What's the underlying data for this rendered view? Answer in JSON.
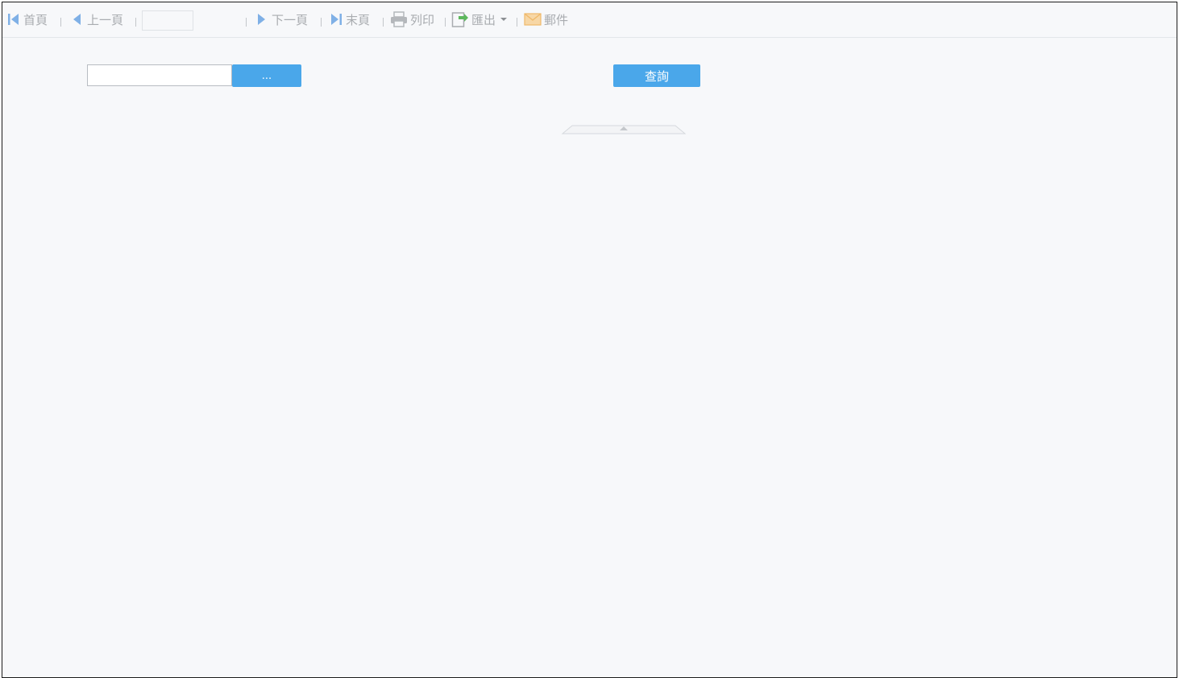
{
  "toolbar": {
    "first_page": "首頁",
    "prev_page": "上一頁",
    "page_input_value": "",
    "next_page": "下一頁",
    "last_page": "末頁",
    "print": "列印",
    "export": "匯出",
    "email": "郵件"
  },
  "params": {
    "text_value": "",
    "browse_button": "...",
    "query_button": "查詢"
  },
  "icons": {
    "first_page": "first-page-icon",
    "prev_page": "prev-page-icon",
    "next_page": "next-page-icon",
    "last_page": "last-page-icon",
    "print": "printer-icon",
    "export": "export-icon",
    "email": "mail-icon",
    "collapse": "collapse-up-icon"
  },
  "colors": {
    "accent": "#4aa7ea",
    "nav_icon": "#7fb0e6",
    "export_icon": "#5cb85c",
    "mail_icon": "#f0b96a",
    "page_background": "#f7f8fa"
  }
}
